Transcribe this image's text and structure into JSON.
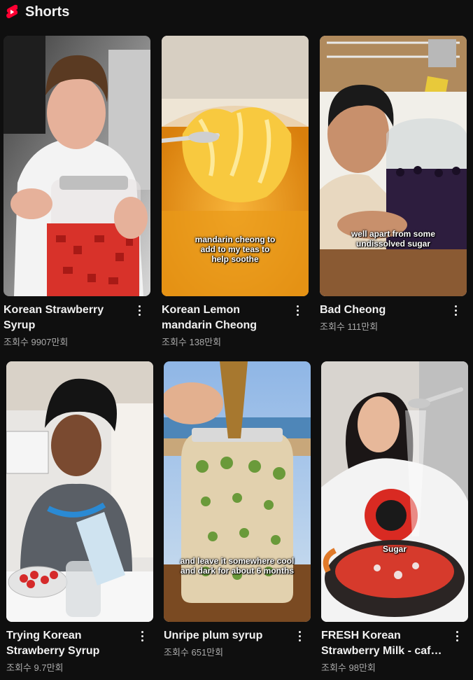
{
  "section": {
    "title": "Shorts",
    "icon": "youtube-shorts-icon",
    "accent": "#ff0033"
  },
  "shorts": [
    {
      "title": "Korean Strawberry Syrup",
      "views": "조회수 9907만회",
      "caption": ""
    },
    {
      "title": "Korean Lemon mandarin Cheong",
      "views": "조회수 138만회",
      "caption": "mandarin cheong to add to my teas to help soothe"
    },
    {
      "title": "Bad Cheong",
      "views": "조회수 111만회",
      "caption": "well apart from some undissolved sugar"
    },
    {
      "title": "Trying Korean Strawberry Syrup",
      "views": "조회수 9.7만회",
      "caption": ""
    },
    {
      "title": "Unripe plum syrup",
      "views": "조회수 651만회",
      "caption": "and leave it somewhere cool and dark for about 6 months"
    },
    {
      "title": "FRESH Korean Strawberry Milk - cafe style",
      "views": "조회수 98만회",
      "caption": "Sugar"
    }
  ]
}
